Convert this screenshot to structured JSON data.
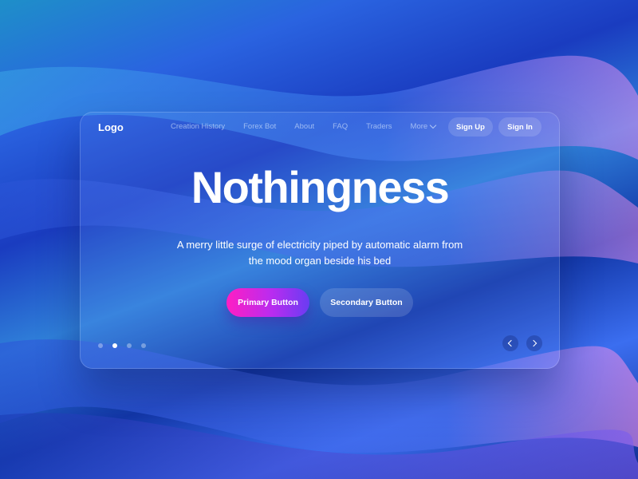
{
  "nav": {
    "logo": "Logo",
    "links": [
      "Creation History",
      "Forex Bot",
      "About",
      "FAQ",
      "Traders"
    ],
    "more_label": "More",
    "sign_up": "Sign Up",
    "sign_in": "Sign In"
  },
  "hero": {
    "title": "Nothingness",
    "subtitle": "A merry little surge of electricity piped by automatic alarm from the mood organ beside his bed",
    "primary_button": "Primary Button",
    "secondary_button": "Secondary Button"
  },
  "carousel": {
    "slide_count": 4,
    "active_index": 1
  },
  "colors": {
    "primary_start": "#ff1ec3",
    "primary_end": "#6a3cf2",
    "background": "#1a3fb8"
  }
}
